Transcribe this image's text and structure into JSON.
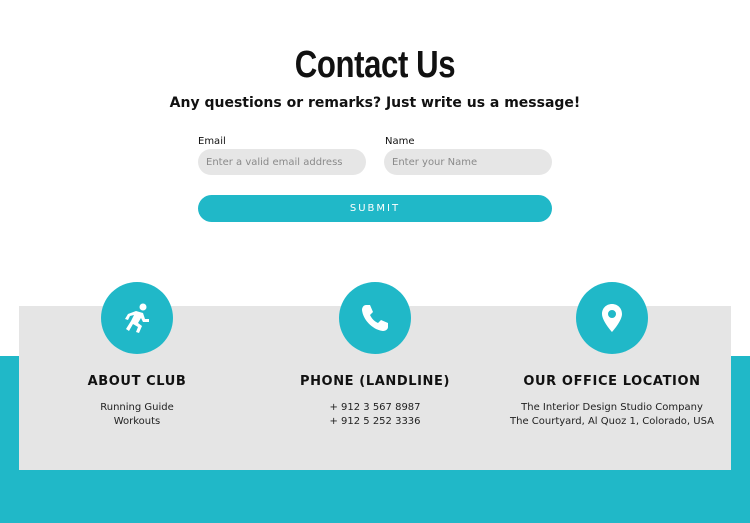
{
  "header": {
    "title": "Contact Us",
    "subtitle": "Any questions or remarks? Just write us a message!"
  },
  "form": {
    "email": {
      "label": "Email",
      "placeholder": "Enter a valid email address"
    },
    "name": {
      "label": "Name",
      "placeholder": "Enter your Name"
    },
    "submit_label": "SUBMIT"
  },
  "info": [
    {
      "icon": "running-person-icon",
      "title": "ABOUT CLUB",
      "lines": [
        "Running Guide",
        "Workouts"
      ]
    },
    {
      "icon": "phone-icon",
      "title": "PHONE (LANDLINE)",
      "lines": [
        "+ 912 3 567 8987",
        "+ 912 5 252 3336"
      ]
    },
    {
      "icon": "location-pin-icon",
      "title": "OUR OFFICE LOCATION",
      "lines": [
        "The Interior Design Studio Company",
        "The Courtyard, Al Quoz 1, Colorado,  USA"
      ]
    }
  ],
  "colors": {
    "accent": "#20b8c8",
    "panel": "#e5e5e5",
    "input_bg": "#e6e6e6",
    "text": "#111111"
  }
}
